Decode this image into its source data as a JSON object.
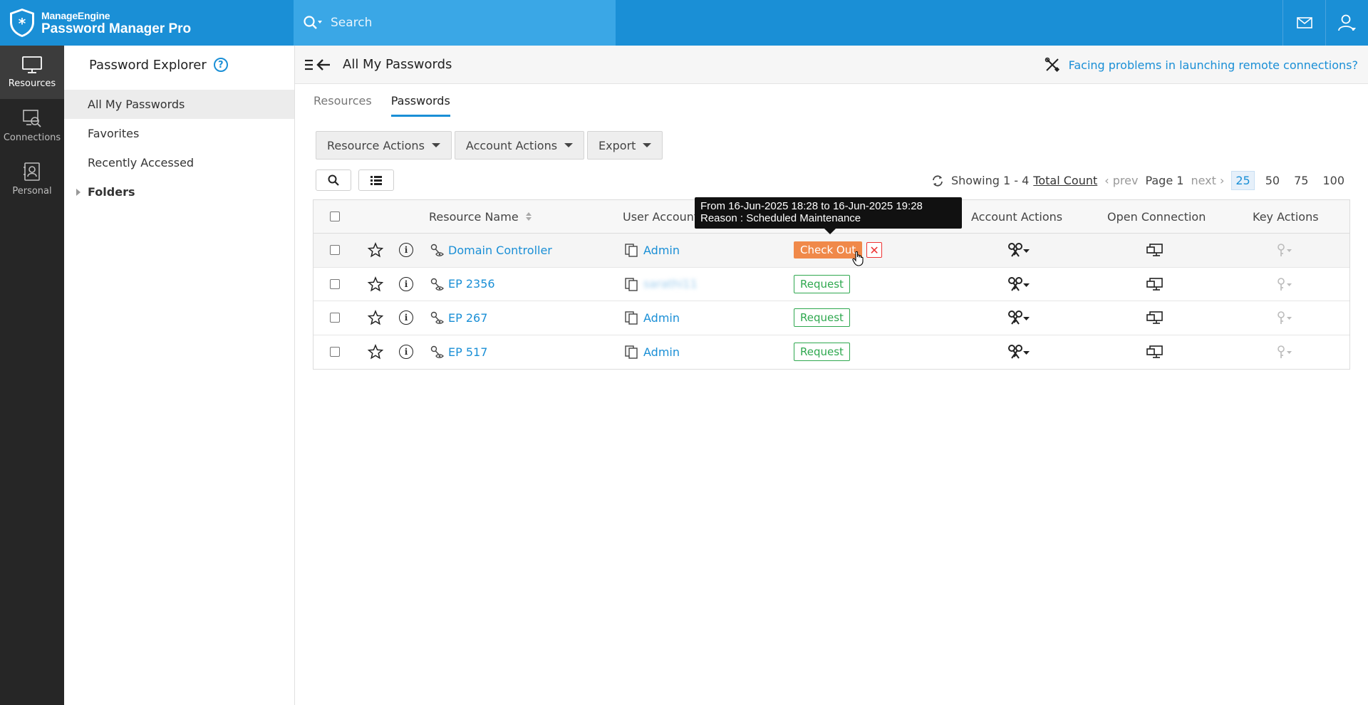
{
  "brand": {
    "line1": "ManageEngine",
    "line2": "Password Manager Pro"
  },
  "search": {
    "placeholder": "Search"
  },
  "rail": [
    {
      "label": "Resources",
      "icon": "monitor-icon"
    },
    {
      "label": "Connections",
      "icon": "connections-icon"
    },
    {
      "label": "Personal",
      "icon": "personal-icon"
    }
  ],
  "sidebar": {
    "title": "Password Explorer",
    "items": [
      "All My Passwords",
      "Favorites",
      "Recently Accessed"
    ],
    "folders": "Folders"
  },
  "header": {
    "title": "All My Passwords",
    "help_link": "Facing problems in launching remote connections?"
  },
  "tabs": [
    "Resources",
    "Passwords"
  ],
  "toolbar": {
    "resource_actions": "Resource Actions",
    "account_actions": "Account Actions",
    "export": "Export"
  },
  "pager": {
    "showing": "Showing 1 - 4",
    "total": "Total Count",
    "prev": "prev",
    "page": "Page 1",
    "next": "next",
    "sizes": [
      "25",
      "50",
      "75",
      "100"
    ],
    "selected_size": "25"
  },
  "table": {
    "columns": [
      "Resource Name",
      "User Account",
      "Account Actions",
      "Open Connection",
      "Key Actions"
    ],
    "rows": [
      {
        "resource": "Domain Controller",
        "account": "Admin",
        "action": "Check Out"
      },
      {
        "resource": "EP 2356",
        "account": "sarathi11",
        "action": "Request"
      },
      {
        "resource": "EP 267",
        "account": "Admin",
        "action": "Request"
      },
      {
        "resource": "EP 517",
        "account": "Admin",
        "action": "Request"
      }
    ]
  },
  "tooltip": {
    "line1": "From 16-Jun-2025 18:28 to 16-Jun-2025 19:28",
    "line2": "Reason : Scheduled Maintenance"
  },
  "colors": {
    "accent": "#1a8fd6",
    "checkout": "#f0894a",
    "request": "#2fa84f",
    "rail": "#262626"
  }
}
